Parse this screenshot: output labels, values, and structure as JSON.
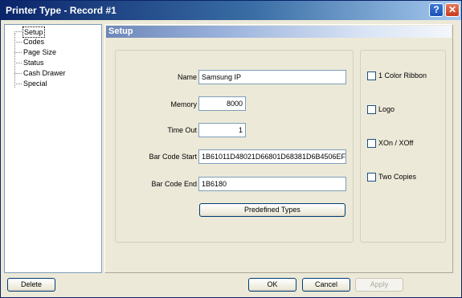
{
  "window": {
    "title": "Printer Type - Record #1",
    "help_glyph": "?",
    "close_glyph": "✕"
  },
  "tree": {
    "items": [
      "Setup",
      "Codes",
      "Page Size",
      "Status",
      "Cash Drawer",
      "Special"
    ],
    "selected": "Setup"
  },
  "panel": {
    "title": "Setup"
  },
  "form": {
    "name_label": "Name",
    "name_value": "Samsung IP",
    "memory_label": "Memory",
    "memory_value": "8000",
    "timeout_label": "Time Out",
    "timeout_value": "1",
    "barcode_start_label": "Bar Code Start",
    "barcode_start_value": "1B61011D48021D66801D68381D6B4506EF",
    "barcode_end_label": "Bar Code End",
    "barcode_end_value": "1B6180",
    "predefined_button": "Predefined Types"
  },
  "options": [
    {
      "label": "1 Color Ribbon",
      "checked": false
    },
    {
      "label": "Logo",
      "checked": false
    },
    {
      "label": "XOn / XOff",
      "checked": false
    },
    {
      "label": "Two Copies",
      "checked": false
    }
  ],
  "footer": {
    "delete": "Delete",
    "ok": "OK",
    "cancel": "Cancel",
    "apply": "Apply"
  },
  "colors": {
    "title_start": "#0a246a",
    "title_end": "#a6caf0",
    "face": "#ece9d8"
  }
}
